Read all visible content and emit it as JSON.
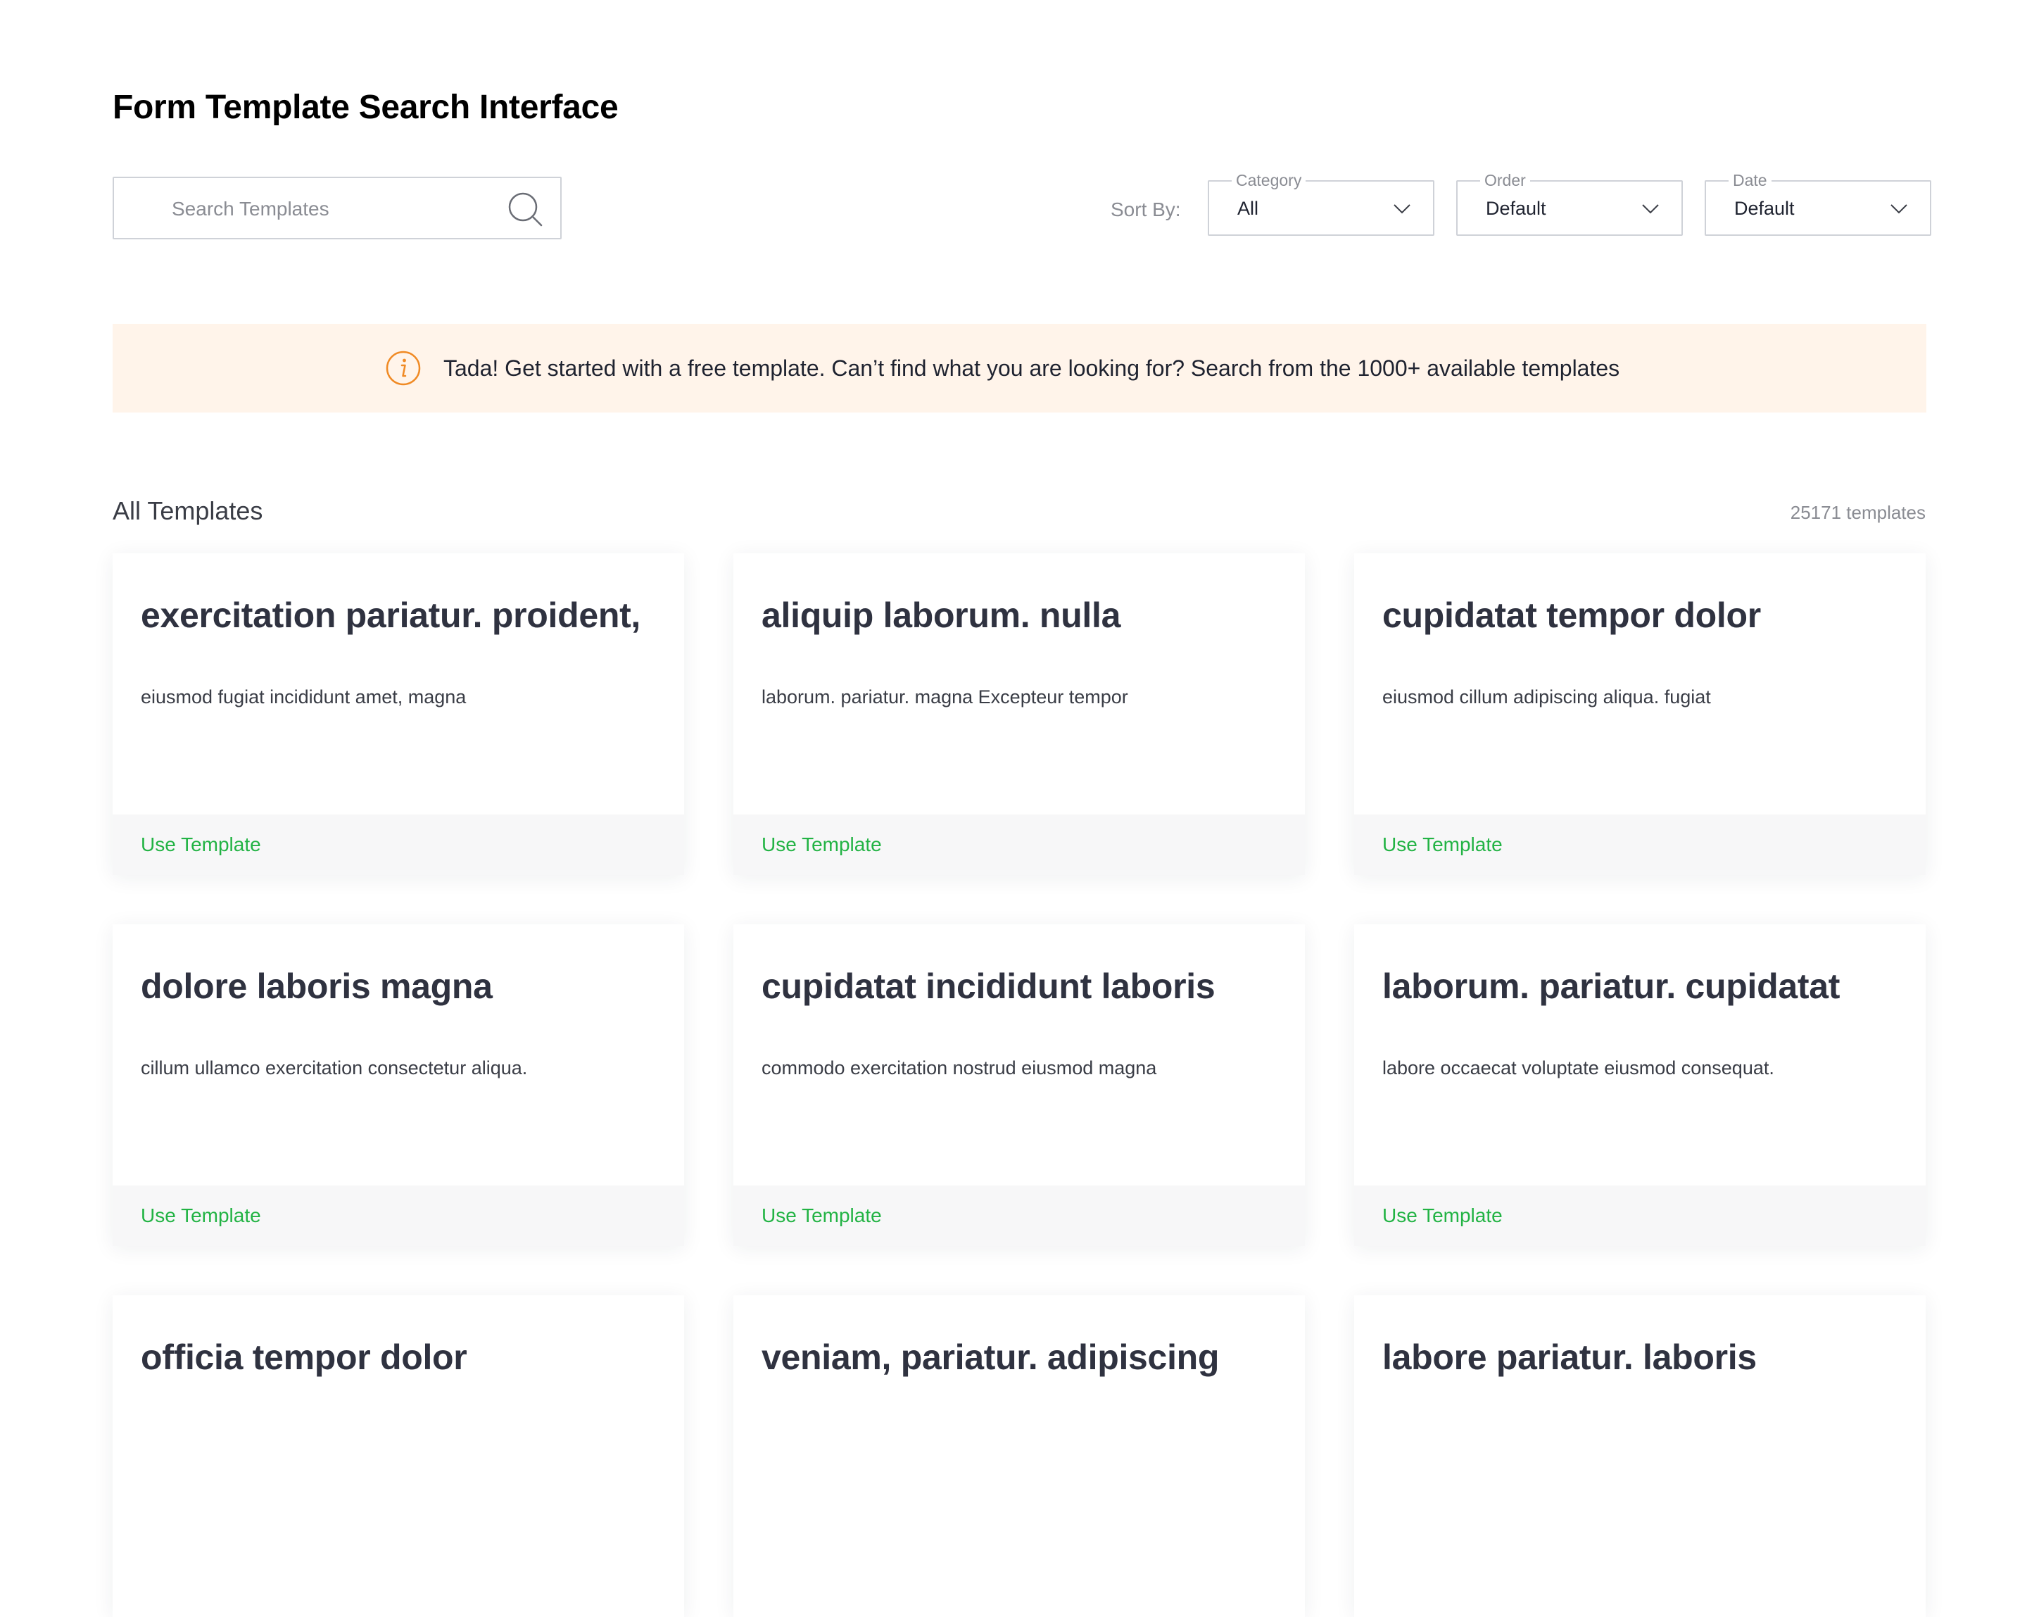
{
  "page": {
    "title": "Form Template Search Interface"
  },
  "search": {
    "placeholder": "Search Templates",
    "value": ""
  },
  "sort": {
    "label": "Sort By:",
    "filters": [
      {
        "legend": "Category",
        "value": "All"
      },
      {
        "legend": "Order",
        "value": "Default"
      },
      {
        "legend": "Date",
        "value": "Default"
      }
    ]
  },
  "banner": {
    "text": "Tada! Get started with a free template. Can’t find what you are looking for? Search from the 1000+ available templates",
    "icon": "info-icon"
  },
  "templates": {
    "section_title": "All Templates",
    "count_text": "25171 templates",
    "action_label": "Use Template",
    "items": [
      {
        "title": "exercitation pariatur. proident,",
        "description": "eiusmod fugiat incididunt amet, magna"
      },
      {
        "title": "aliquip laborum. nulla",
        "description": "laborum. pariatur. magna Excepteur tempor"
      },
      {
        "title": "cupidatat tempor dolor",
        "description": "eiusmod cillum adipiscing aliqua. fugiat"
      },
      {
        "title": "dolore laboris magna",
        "description": "cillum ullamco exercitation consectetur aliqua."
      },
      {
        "title": "cupidatat incididunt laboris",
        "description": "commodo exercitation nostrud eiusmod magna"
      },
      {
        "title": "laborum. pariatur. cupidatat",
        "description": "labore occaecat voluptate eiusmod consequat."
      },
      {
        "title": "officia tempor dolor",
        "description": ""
      },
      {
        "title": "veniam, pariatur. adipiscing",
        "description": ""
      },
      {
        "title": "labore pariatur. laboris",
        "description": ""
      }
    ]
  },
  "colors": {
    "accent_green": "#22b344",
    "banner_bg": "#fff4ea",
    "info_orange": "#f08a24"
  }
}
